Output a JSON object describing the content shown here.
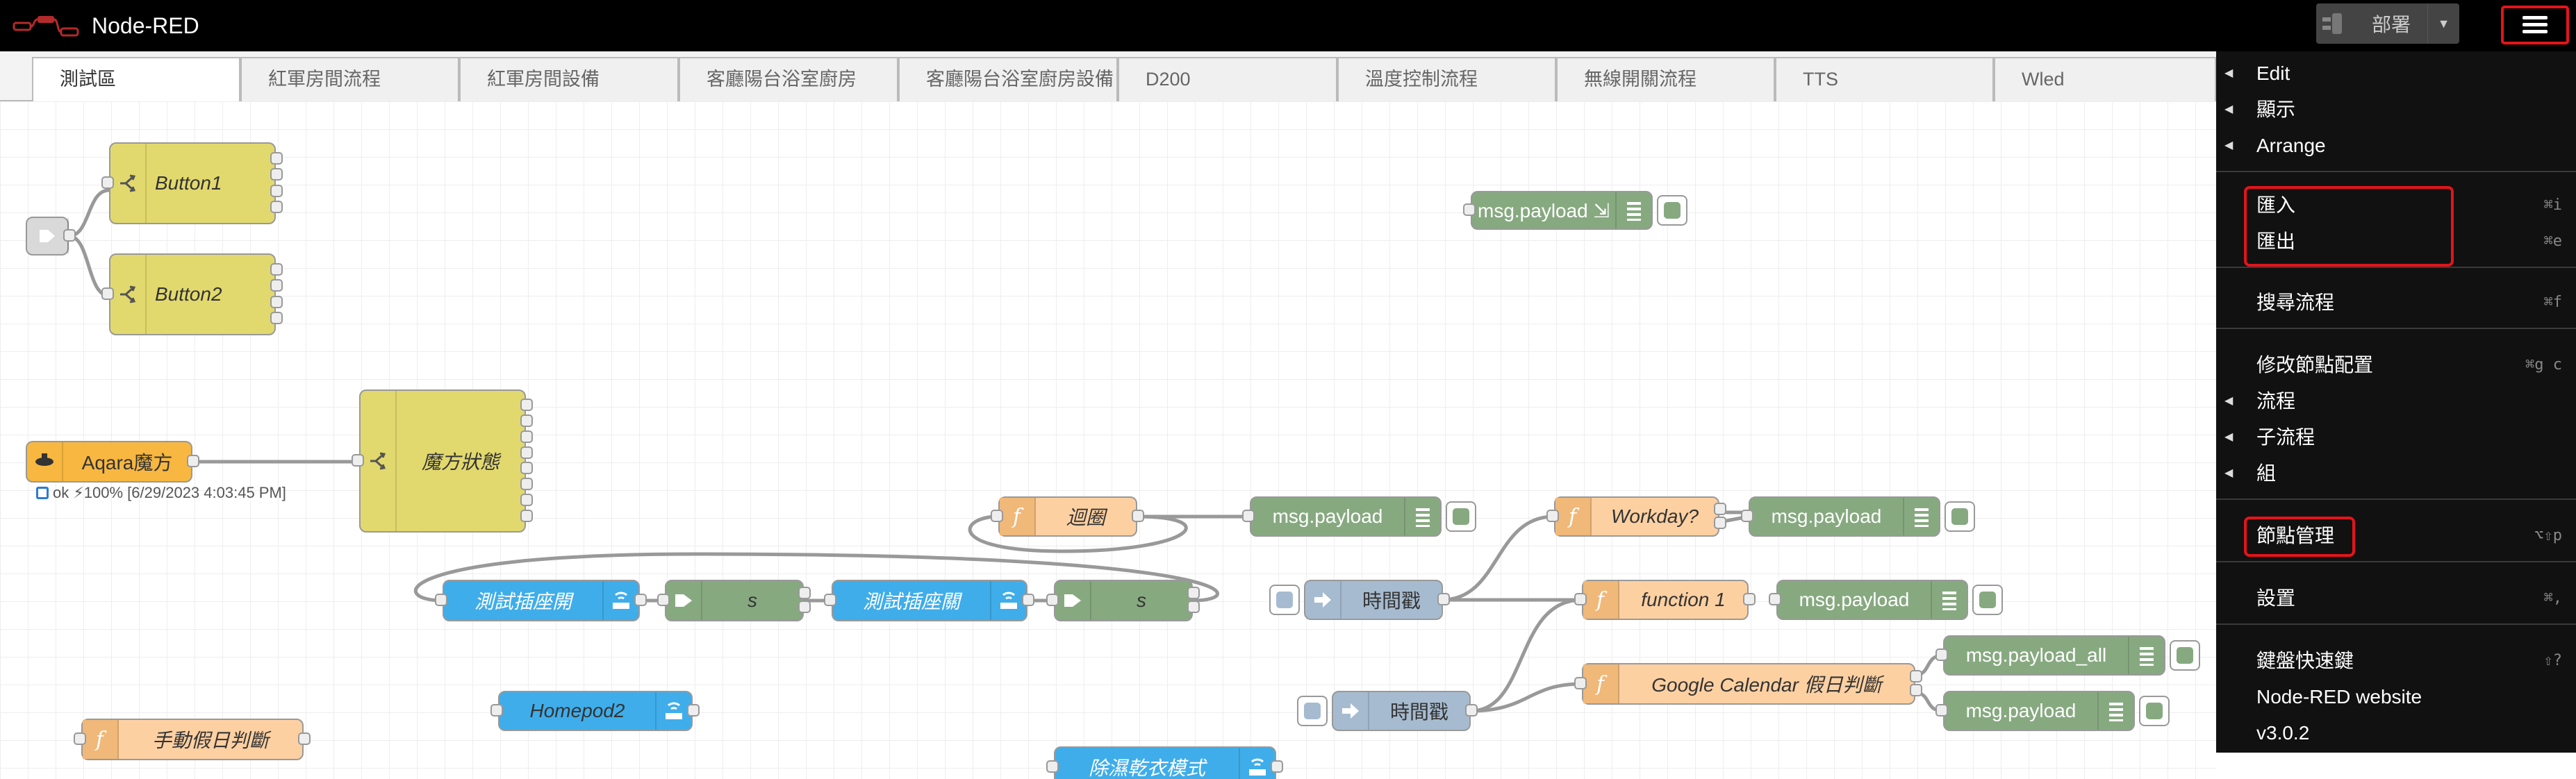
{
  "header": {
    "app_title": "Node-RED",
    "deploy_label": "部署",
    "menu_icon": "hamburger-icon",
    "logo_icon": "node-red-logo-icon"
  },
  "tabs": [
    "測試區",
    "紅軍房間流程",
    "紅軍房間設備",
    "客廳陽台浴室廚房",
    "客廳陽台浴室廚房設備",
    "D200",
    "溫度控制流程",
    "無線開關流程",
    "TTS",
    "Wled"
  ],
  "nodes": {
    "button1": "Button1",
    "button2": "Button2",
    "aqara": "Aqara魔方",
    "aqara_status": "ok ⚡100% [6/29/2023 4:03:45 PM]",
    "magic_state": "魔方狀態",
    "msg_payload": "msg.payload",
    "msg_payload_arrow": "msg.payload ⇲",
    "msg_payload_all": "msg.payload_all",
    "loop": "迴圈",
    "workday": "Workday?",
    "function1": "function 1",
    "google_cal": "Google Calendar 假日判斷",
    "timestamp": "時間戳",
    "test_socket_on": "測試插座開",
    "test_socket_off": "測試插座關",
    "s": "s",
    "homepod": "Homepod2",
    "manual_holiday": "手動假日判斷",
    "dehumid": "除濕乾衣模式"
  },
  "menu": {
    "edit": "Edit",
    "view": "顯示",
    "arrange": "Arrange",
    "import": "匯入",
    "import_key": "⌘i",
    "export": "匯出",
    "export_key": "⌘e",
    "search": "搜尋流程",
    "search_key": "⌘f",
    "config": "修改節點配置",
    "config_key": "⌘g c",
    "flows": "流程",
    "subflows": "子流程",
    "groups": "組",
    "palette": "節點管理",
    "palette_key": "⌥⇧p",
    "settings": "設置",
    "settings_key": "⌘,",
    "shortcuts": "鍵盤快速鍵",
    "shortcuts_key": "⇧?",
    "website": "Node-RED website",
    "version": "v3.0.2"
  },
  "colors": {
    "header": "#000000",
    "menu_bg": "#111111",
    "highlight": "#e3141a",
    "switch": "#e2d96e",
    "debug": "#87a980",
    "function": "#fdd0a2",
    "inject": "#a6bbcf",
    "homekit": "#3fadea",
    "aqara": "#f7b740"
  }
}
